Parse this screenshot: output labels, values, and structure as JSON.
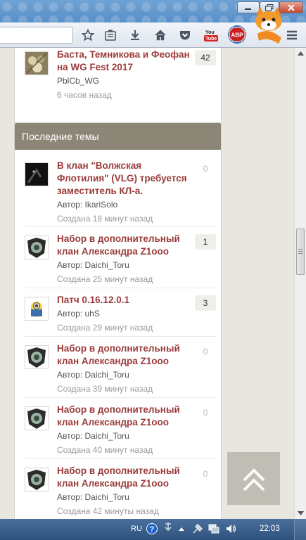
{
  "browser": {
    "window_buttons": [
      "minimize",
      "maximize",
      "close"
    ],
    "toolbar_icons": [
      "star-icon",
      "reading-list-icon",
      "download-icon",
      "home-icon",
      "pocket-icon",
      "youtube-icon",
      "adblock-icon",
      "menu-icon"
    ],
    "youtube_label": "You Tube",
    "adblock_label": "ABP"
  },
  "top_card": {
    "title": "Баста, Темникова и Феофан на WG Fest 2017",
    "author": "PblCb_WG",
    "date": "6 часов назад",
    "count": "42"
  },
  "latest": {
    "header": "Последние темы",
    "topics": [
      {
        "title": "В клан \"Волжская Флотилия\" (VLG) требуется заместитель КЛ-а.",
        "author": "Автор: IkariSolo",
        "date": "Создана 18 минут назад",
        "count": "0"
      },
      {
        "title": "Набор в дополнительный клан Александра Z1ooo",
        "author": "Автор: Daichi_Toru",
        "date": "Создана 25 минут назад",
        "count": "1"
      },
      {
        "title": "Патч 0.16.12.0.1",
        "author": "Автор: uhS",
        "date": "Создана 29 минут назад",
        "count": "3"
      },
      {
        "title": "Набор в дополнительный клан Александра Z1ooo",
        "author": "Автор: Daichi_Toru",
        "date": "Создана 39 минут назад",
        "count": "0"
      },
      {
        "title": "Набор в дополнительный клан Александра Z1ooo",
        "author": "Автор: Daichi_Toru",
        "date": "Создана 40 минут назад",
        "count": "0"
      },
      {
        "title": "Набор в дополнительный клан Александра Z1ooo",
        "author": "Автор: Daichi_Toru",
        "date": "Создана 42 минуты назад",
        "count": "0"
      }
    ]
  },
  "taskbar": {
    "language": "RU",
    "time": "22:03"
  },
  "colors": {
    "accent": "#9a3b3b",
    "header_bg": "#8c8676",
    "page_bg": "#e8e6df"
  }
}
